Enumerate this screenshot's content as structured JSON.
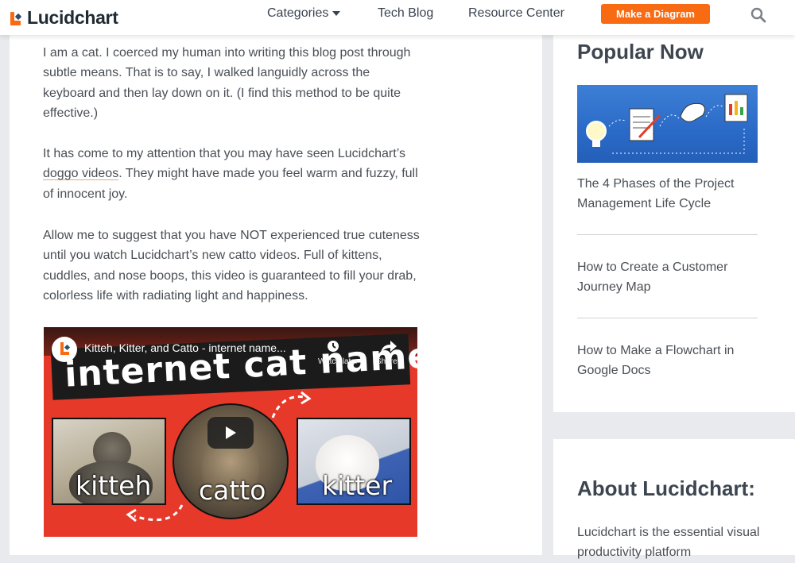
{
  "header": {
    "logo_text": "Lucidchart",
    "nav": [
      {
        "label": "Categories"
      },
      {
        "label": "Tech Blog"
      },
      {
        "label": "Resource Center"
      }
    ],
    "cta_label": "Make a Diagram"
  },
  "article": {
    "paragraphs": [
      "I am a cat. I coerced my human into writing this blog post through subtle means. That is to say, I walked languidly across the keyboard and then lay down on it. (I find this method to be quite effective.)",
      "Allow me to suggest that you have NOT experienced true cuteness until you watch Lucidchart’s new catto videos. Full of kittens, cuddles, and nose boops, this video is guaranteed to fill your drab, colorless life with radiating light and happiness."
    ],
    "para2_before": "It has come to my attention that you may have seen Lucidchart’s ",
    "para2_link": "doggo videos",
    "para2_after": ". They might have made you feel warm and fuzzy, full of innocent joy."
  },
  "video": {
    "title": "Kitteh, Kitter, and Catto - internet name...",
    "big_title": "internet cat names",
    "watch_later_label": "Watch later",
    "share_label": "Share",
    "words": [
      "kitteh",
      "catto",
      "kitter"
    ]
  },
  "sidebar": {
    "popular_heading": "Popular Now",
    "popular_items": [
      {
        "title": "The 4 Phases of the Project Management Life Cycle"
      },
      {
        "title": "How to Create a Customer Journey Map"
      },
      {
        "title": "How to Make a Flowchart in Google Docs"
      }
    ],
    "about_heading": "About Lucidchart:",
    "about_text": "Lucidchart is the essential visual productivity platform"
  },
  "colors": {
    "brand_orange": "#f96b13",
    "brand_navy": "#2b4d6e",
    "video_red": "#e6392a",
    "thumb_blue": "#2a6ac7"
  },
  "icons": {
    "search": "search-icon",
    "caret": "chevron-down-icon",
    "play": "play-icon",
    "watch_later": "clock-icon",
    "share": "share-icon"
  }
}
